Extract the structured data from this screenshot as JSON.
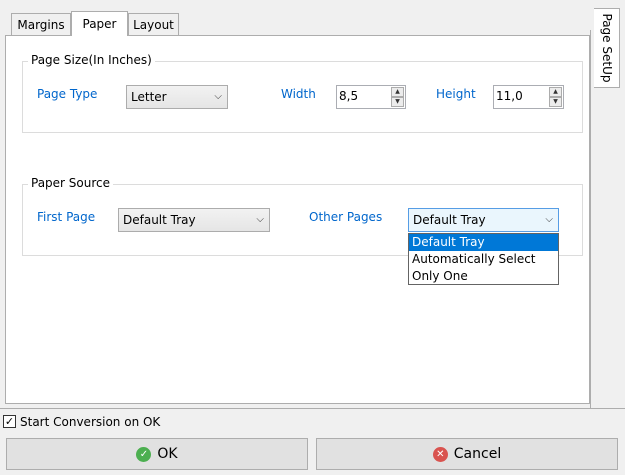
{
  "tabs": [
    {
      "label": "Margins"
    },
    {
      "label": "Paper",
      "active": true
    },
    {
      "label": "Layout"
    }
  ],
  "side_tab": {
    "label": "Page SetUp"
  },
  "page_size": {
    "title": "Page Size(In Inches)",
    "page_type_label": "Page Type",
    "page_type_value": "Letter",
    "width_label": "Width",
    "width_value": "8,5",
    "height_label": "Height",
    "height_value": "11,0"
  },
  "paper_source": {
    "title": "Paper Source",
    "first_page_label": "First Page",
    "first_page_value": "Default Tray",
    "other_pages_label": "Other Pages",
    "other_pages_value": "Default Tray",
    "other_pages_options": [
      "Default Tray",
      "Automatically Select",
      "Only One"
    ]
  },
  "footer": {
    "checkbox_label": "Start Conversion on OK",
    "checked": true,
    "ok_label": "OK",
    "cancel_label": "Cancel"
  },
  "colors": {
    "accent": "#0066cc",
    "selection": "#0078d7"
  }
}
